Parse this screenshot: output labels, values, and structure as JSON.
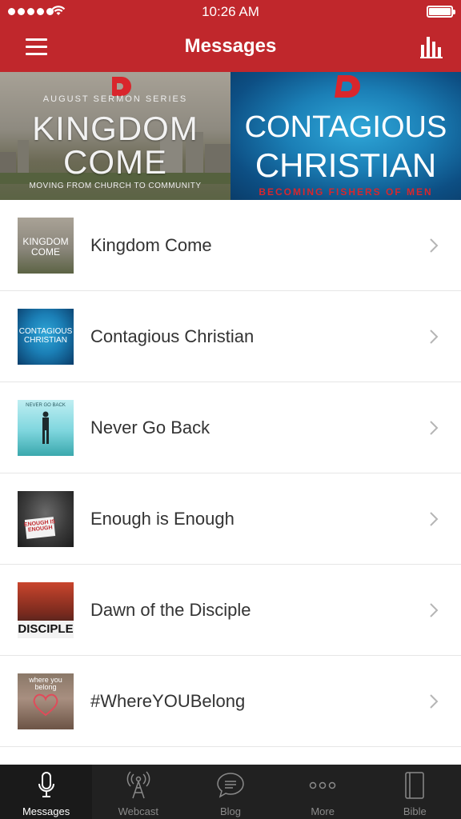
{
  "status_bar": {
    "time": "10:26 AM"
  },
  "navbar": {
    "title": "Messages",
    "menu_icon": "hamburger-menu-icon",
    "right_icon": "bar-chart-icon"
  },
  "colors": {
    "brand": "#c0272c",
    "tabbar": "#212121",
    "accent_red": "#d9262c"
  },
  "banners": [
    {
      "logo": "NEW",
      "kicker": "AUGUST SERMON SERIES",
      "title_line1": "KINGDOM",
      "title_line2": "COME",
      "tagline": "MOVING FROM CHURCH TO COMMUNITY"
    },
    {
      "logo": "NEW",
      "title_line1": "CONTAGIOUS",
      "title_line2": "CHRISTIAN",
      "tagline": "BECOMING FISHERS OF MEN"
    }
  ],
  "messages": [
    {
      "label": "Kingdom Come",
      "thumb_text": "KINGDOM COME"
    },
    {
      "label": "Contagious Christian",
      "thumb_text": "CONTAGIOUS CHRISTIAN"
    },
    {
      "label": "Never Go Back",
      "thumb_text": "NEVER GO BACK"
    },
    {
      "label": "Enough is Enough",
      "thumb_text": "ENOUGH IS ENOUGH"
    },
    {
      "label": "Dawn of the Disciple",
      "thumb_text": "DISCIPLE"
    },
    {
      "label": "#WhereYOUBelong",
      "thumb_text": "where you belong"
    }
  ],
  "tabs": [
    {
      "label": "Messages",
      "icon": "microphone-icon",
      "active": true
    },
    {
      "label": "Webcast",
      "icon": "broadcast-tower-icon",
      "active": false
    },
    {
      "label": "Blog",
      "icon": "speech-bubble-icon",
      "active": false
    },
    {
      "label": "More",
      "icon": "more-dots-icon",
      "active": false
    },
    {
      "label": "Bible",
      "icon": "book-icon",
      "active": false
    }
  ]
}
